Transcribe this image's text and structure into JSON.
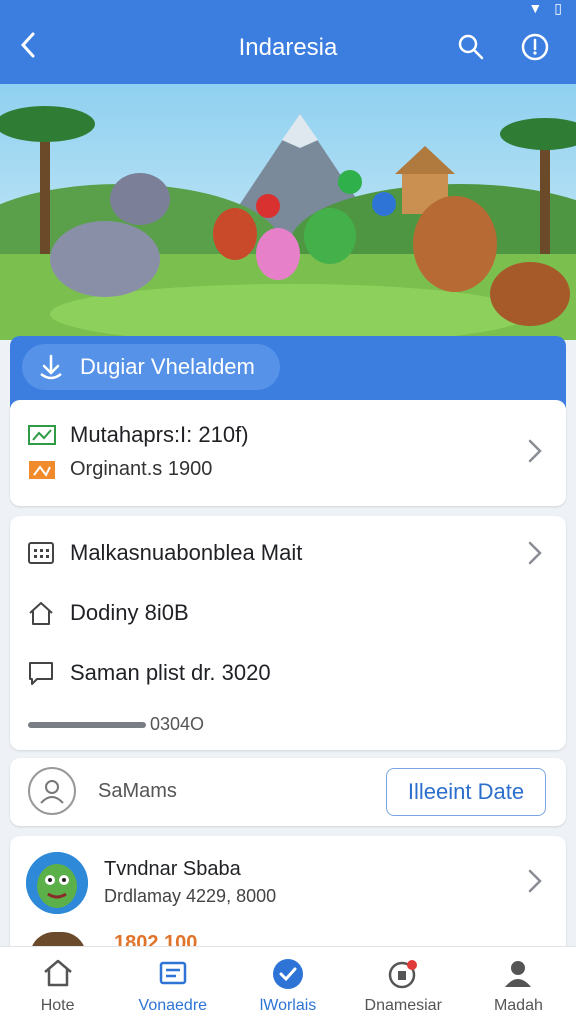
{
  "header": {
    "title": "Indaresia"
  },
  "banner_strip": {
    "label": "Dugiar Vhelaldem"
  },
  "card1": {
    "line1": "Mutahaprs:I: 210f)",
    "line2": "Orginant.s 1900"
  },
  "card2": {
    "row1": "Malkasnuabonblea Mait",
    "row2": "Dodiny 8i0B",
    "row3": "Saman plist dr. 3020",
    "row4": "0304O"
  },
  "card3": {
    "label": "SaMams",
    "button": "Illeeint Date"
  },
  "card4": {
    "name": "Tvndnar Sbaba",
    "sub": "Drdlamay 4229, 8000",
    "partial": "1802 100"
  },
  "nav": [
    {
      "label": "Hote",
      "icon": "home-icon"
    },
    {
      "label": "Vonaedre",
      "icon": "inbox-icon"
    },
    {
      "label": "lWorlais",
      "icon": "check-badge-icon"
    },
    {
      "label": "Dnamesiar",
      "icon": "notification-icon"
    },
    {
      "label": "Madah",
      "icon": "profile-icon"
    }
  ],
  "colors": {
    "primary": "#3b7ee0",
    "accent": "#2e74d6"
  }
}
